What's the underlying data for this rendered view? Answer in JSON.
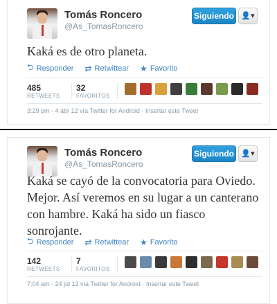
{
  "tweets": [
    {
      "name": "Tomás Roncero",
      "handle": "@As_TomasRoncero",
      "follow_label": "Siguiendo",
      "user_menu_label": "👤▾",
      "text": "Kaká es de otro planeta.",
      "actions": [
        {
          "label": "Responder",
          "icon": "reply-icon"
        },
        {
          "label": "Retwittear",
          "icon": "retweet-icon"
        },
        {
          "label": "Favorito",
          "icon": "star-icon"
        }
      ],
      "retweets_count": "485",
      "retweets_label": "RETWEETS",
      "favorites_count": "32",
      "favorites_label": "FAVORITOS",
      "face_colors": [
        "#a46c2c",
        "#c0312b",
        "#d8a13b",
        "#3f3f3f",
        "#3a7d3a",
        "#5b3a2d",
        "#7a9b4e",
        "#2a2a2a",
        "#8b2a21"
      ],
      "meta": "3:29 pm - 4 abr 12 vía Twitter for Android · Insertar este Tweet"
    },
    {
      "name": "Tomás Roncero",
      "handle": "@As_TomasRoncero",
      "follow_label": "Siguiendo",
      "user_menu_label": "👤▾",
      "text": "Kaká se cayó de la convocatoria para Oviedo. Mejor. Así veremos en su lugar a un canterano con hambre. Kaká ha sido un fiasco sonrojante.",
      "actions": [
        {
          "label": "Responder",
          "icon": "reply-icon"
        },
        {
          "label": "Retwittear",
          "icon": "retweet-icon"
        },
        {
          "label": "Favorito",
          "icon": "star-icon"
        }
      ],
      "retweets_count": "142",
      "retweets_label": "RETWEETS",
      "favorites_count": "7",
      "favorites_label": "FAVORITOS",
      "face_colors": [
        "#4b4b4b",
        "#6a8cab",
        "#3a3a3a",
        "#c9783a",
        "#2e2e2e",
        "#7b6a4f",
        "#c5352c",
        "#a88c52",
        "#6b4b3a"
      ],
      "meta": "7:04 am - 24 jul 12 vía Twitter for Android · Insertar este Tweet"
    }
  ],
  "colors": {
    "link_blue": "#3b82c4",
    "follow_blue": "#1d85c5",
    "muted": "#8899a6"
  }
}
